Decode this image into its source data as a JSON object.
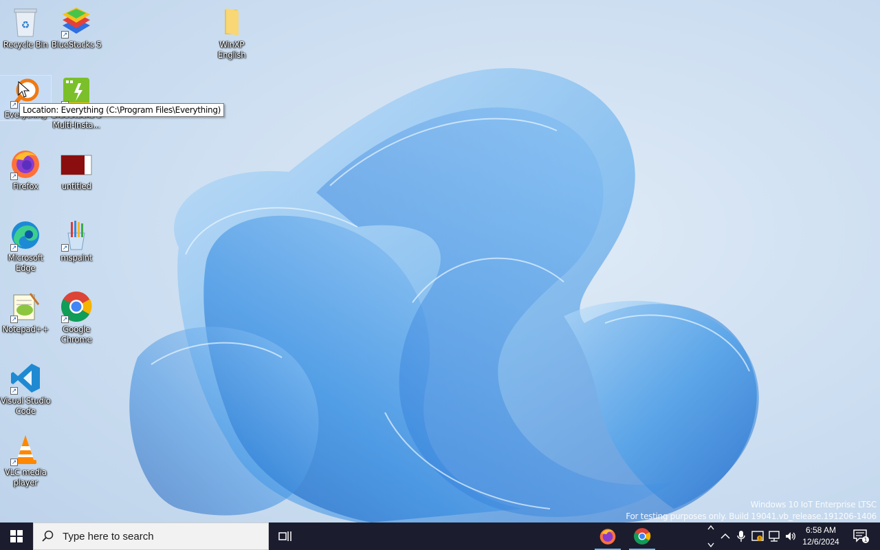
{
  "desktop": {
    "icons": [
      {
        "label": "Recycle Bin",
        "icon": "recycle-bin-icon"
      },
      {
        "label": "BlueStacks 5",
        "icon": "bluestacks-icon"
      },
      {
        "label": "WinXP English",
        "icon": "folder-icon"
      },
      {
        "label": "Everything",
        "icon": "everything-search-icon"
      },
      {
        "label": "BlueStacks 5 Multi-Insta...",
        "icon": "bluestacks-multi-instance-icon"
      },
      {
        "label": "Firefox",
        "icon": "firefox-icon"
      },
      {
        "label": "untitled",
        "icon": "document-icon"
      },
      {
        "label": "Microsoft Edge",
        "icon": "edge-icon"
      },
      {
        "label": "mspaint",
        "icon": "paint-icon"
      },
      {
        "label": "Notepad++",
        "icon": "notepadpp-icon"
      },
      {
        "label": "Google Chrome",
        "icon": "chrome-icon"
      },
      {
        "label": "Visual Studio Code",
        "icon": "vscode-icon"
      },
      {
        "label": "VLC media player",
        "icon": "vlc-icon"
      }
    ],
    "tooltip": "Location: Everything (C:\\Program Files\\Everything)",
    "watermark": {
      "line1": "Windows 10 IoT Enterprise LTSC",
      "line2": "For testing purposes only. Build 19041.vb_release.191206-1406"
    }
  },
  "taskbar": {
    "search_placeholder": "Type here to search",
    "pinned": [
      {
        "name": "Firefox",
        "icon": "firefox-icon"
      },
      {
        "name": "Google Chrome",
        "icon": "chrome-icon"
      }
    ],
    "tray": {
      "icons": [
        "chevron-up-icon",
        "microphone-icon",
        "security-icon",
        "network-icon",
        "volume-icon"
      ],
      "time": "6:58 AM",
      "date": "12/6/2024",
      "notification_count": "1"
    }
  },
  "colors": {
    "taskbar": "#1b1d2e",
    "wallpaper_bg": "#cfe0f2",
    "accent": "#76b9ed"
  }
}
